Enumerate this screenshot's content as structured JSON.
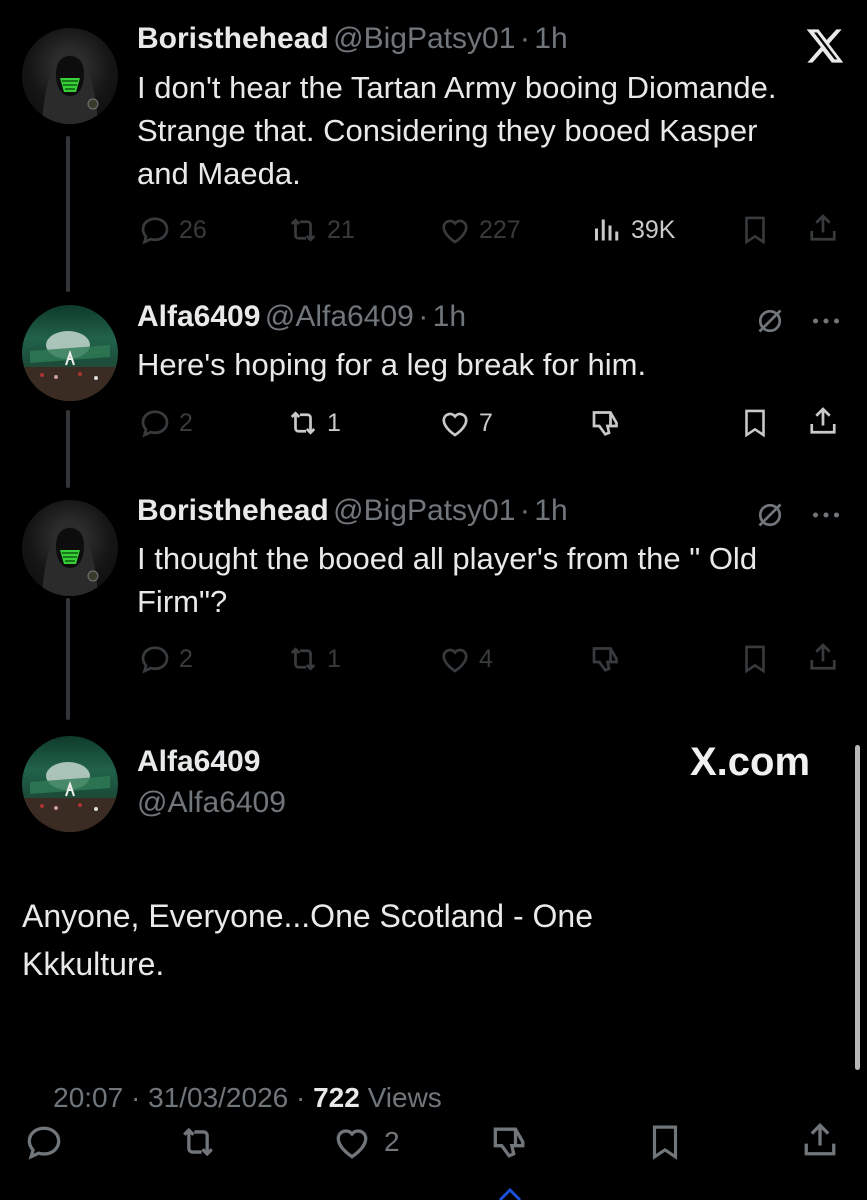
{
  "tweets": [
    {
      "name": "Boristhehead",
      "handle": "@BigPatsy01",
      "sep": "·",
      "time": "1h",
      "text_lines": [
        "I don't hear the Tartan Army booing Diomande.",
        "Strange that. Considering they booed Kasper",
        "and Maeda."
      ],
      "replies": "26",
      "reposts": "21",
      "likes": "227",
      "views": "39K"
    },
    {
      "name": "Alfa6409",
      "handle": "@Alfa6409",
      "sep": "·",
      "time": "1h",
      "text_lines": [
        "Here's hoping for a leg break for him."
      ],
      "replies": "2",
      "reposts": "1",
      "likes": "7"
    },
    {
      "name": "Boristhehead",
      "handle": "@BigPatsy01",
      "sep": "·",
      "time": "1h",
      "text_lines": [
        "I thought the booed all player's from the \" Old",
        "Firm\"?"
      ],
      "replies": "2",
      "reposts": "1",
      "likes": "4"
    }
  ],
  "main_tweet": {
    "name": "Alfa6409",
    "handle": "@Alfa6409",
    "watermark": "X.com",
    "text_lines": [
      "Anyone, Everyone...One Scotland - One",
      "Kkkulture."
    ],
    "timestamp": "20:07 · 31/03/2026 · ",
    "views_count": "722",
    "views_label": " Views",
    "likes": "2"
  },
  "icons": {
    "top_right": "x-logo-icon",
    "tweet_menu": "more-dots-icon",
    "blocked": "muted-circle-slash-icon"
  },
  "colors": {
    "background": "#000000",
    "text": "#e7e9ea",
    "secondary": "#71767b"
  }
}
